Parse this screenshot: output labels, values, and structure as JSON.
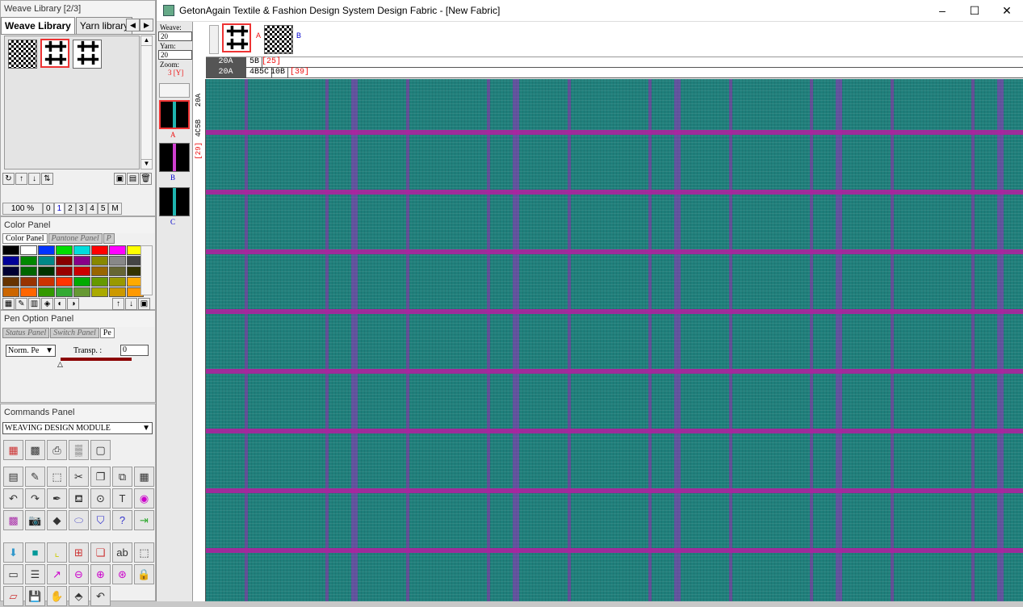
{
  "weave_library": {
    "title": "Weave Library [2/3]",
    "tabs": [
      "Weave Library",
      "Yarn library"
    ],
    "zoom": "100 %",
    "zoom_steps": [
      "0",
      "1",
      "2",
      "3",
      "4",
      "5",
      "M"
    ]
  },
  "color_panel": {
    "title": "Color Panel",
    "tabs": [
      "Color Panel",
      "Pantone Panel",
      "P"
    ],
    "swatches": [
      "#000000",
      "#ffffff",
      "#0033ff",
      "#00dd00",
      "#00dddd",
      "#ff0000",
      "#ff00ff",
      "#ffff00",
      "#000099",
      "#008800",
      "#008888",
      "#880000",
      "#880088",
      "#888800",
      "#888888",
      "#444444",
      "#000033",
      "#006600",
      "#003300",
      "#990000",
      "#cc0000",
      "#996600",
      "#666633",
      "#333300",
      "#663300",
      "#993300",
      "#cc3300",
      "#ff3300",
      "#00aa00",
      "#669900",
      "#999900",
      "#ffaa00",
      "#cc6600",
      "#ff6600",
      "#339900",
      "#33aa33",
      "#669933",
      "#aaaa00",
      "#cc9900",
      "#ff9900"
    ]
  },
  "pen_panel": {
    "title": "Pen Option Panel",
    "tabs": [
      "Status Panel",
      "Switch Panel",
      "Pe"
    ],
    "mode": "Norm. Pe",
    "transp_label": "Transp. :",
    "transp_value": "0"
  },
  "commands_panel": {
    "title": "Commands Panel",
    "module": "WEAVING DESIGN MODULE"
  },
  "window": {
    "title": "GetonAgain Textile & Fashion Design System  Design Fabric - [New Fabric]",
    "minimize": "–",
    "maximize": "☐",
    "close": "✕"
  },
  "sidebar": {
    "weave_label": "Weave:",
    "weave_value": "20",
    "yarn_label": "Yarn:",
    "yarn_value": "20",
    "zoom_label": "Zoom:",
    "zoom_value": "3",
    "zoom_unit": "[Y]",
    "yarn_letters": [
      "A",
      "B",
      "C"
    ]
  },
  "topbar": {
    "weave_a": "A",
    "weave_b": "B"
  },
  "rulers": {
    "row1_label": "20A",
    "row1_mid": "5B",
    "row1_count": "[25]",
    "row2_label": "20A",
    "row2_mid": "4B5C",
    "row2_mid2": "10B",
    "row2_count": "[39]",
    "vertical_top": "20A",
    "vertical_mid": "4C5B",
    "vertical_count": "[29]"
  }
}
